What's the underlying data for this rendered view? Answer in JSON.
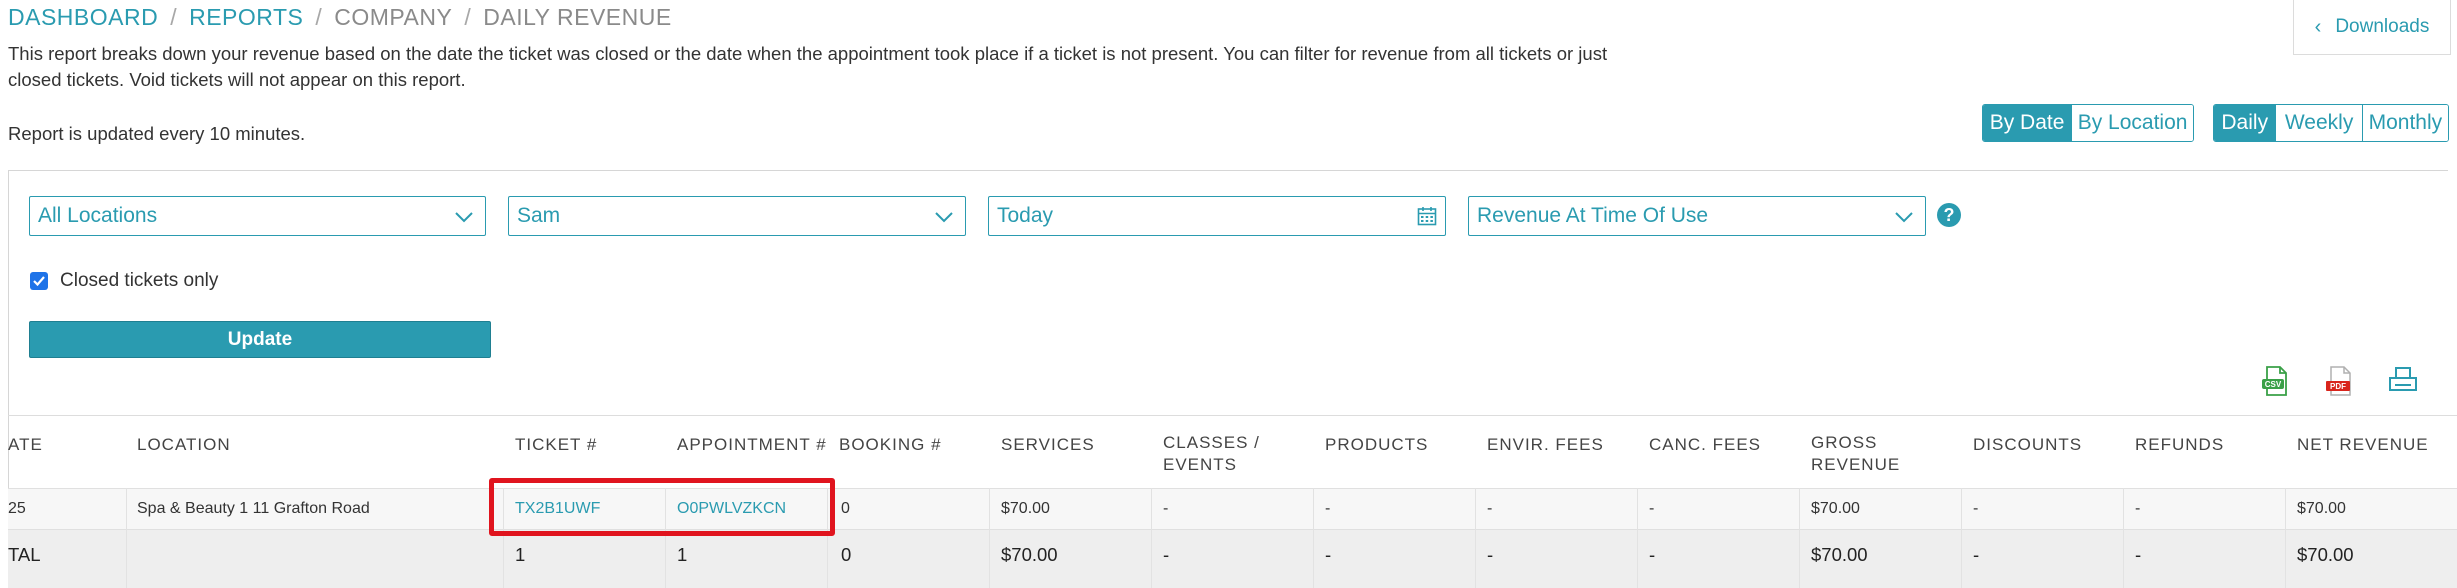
{
  "breadcrumb": [
    {
      "label": "DASHBOARD",
      "link": true
    },
    {
      "label": "REPORTS",
      "link": true
    },
    {
      "label": "COMPANY",
      "link": false
    },
    {
      "label": "DAILY REVENUE",
      "link": false
    }
  ],
  "breadcrumb_separator": "/",
  "description": "This report breaks down your revenue based on the date the ticket was closed or the date when the appointment took place if a ticket is not present. You can filter for revenue from all tickets or just closed tickets. Void tickets will not appear on this report.",
  "updated_note": "Report is updated every 10 minutes.",
  "downloads_label": "Downloads",
  "view_toggle": {
    "by_date": "By Date",
    "by_location": "By Location",
    "active": "By Date"
  },
  "period_toggle": {
    "daily": "Daily",
    "weekly": "Weekly",
    "monthly": "Monthly",
    "active": "Daily"
  },
  "filters": {
    "location": "All Locations",
    "staff": "Sam",
    "date": "Today",
    "revenue_type": "Revenue At Time Of Use"
  },
  "closed_tickets": {
    "label": "Closed tickets only",
    "checked": true
  },
  "update_label": "Update",
  "export_icons": [
    "csv-icon",
    "pdf-icon",
    "print-icon"
  ],
  "table": {
    "headers": {
      "date": "ATE",
      "location": "LOCATION",
      "ticket": "TICKET #",
      "appointment": "APPOINTMENT #",
      "booking": "BOOKING #",
      "services": "SERVICES",
      "classes1": "CLASSES /",
      "classes2": "EVENTS",
      "products": "PRODUCTS",
      "envir": "ENVIR. FEES",
      "canc": "CANC. FEES",
      "gross1": "GROSS",
      "gross2": "REVENUE",
      "discounts": "DISCOUNTS",
      "refunds": "REFUNDS",
      "net": "NET REVENUE"
    },
    "row": {
      "date": "25",
      "location": "Spa & Beauty 1 11 Grafton Road",
      "ticket": "TX2B1UWF",
      "appointment": "O0PWLVZKCN",
      "booking": "0",
      "services": "$70.00",
      "classes": "-",
      "products": "-",
      "envir": "-",
      "canc": "-",
      "gross": "$70.00",
      "discounts": "-",
      "refunds": "-",
      "net": "$70.00"
    },
    "total": {
      "label": "TAL",
      "ticket": "1",
      "appointment": "1",
      "booking": "0",
      "services": "$70.00",
      "classes": "-",
      "products": "-",
      "envir": "-",
      "canc": "-",
      "gross": "$70.00",
      "discounts": "-",
      "refunds": "-",
      "net": "$70.00"
    }
  },
  "colors": {
    "accent": "#2a9bb0",
    "highlight": "#e0141e"
  }
}
